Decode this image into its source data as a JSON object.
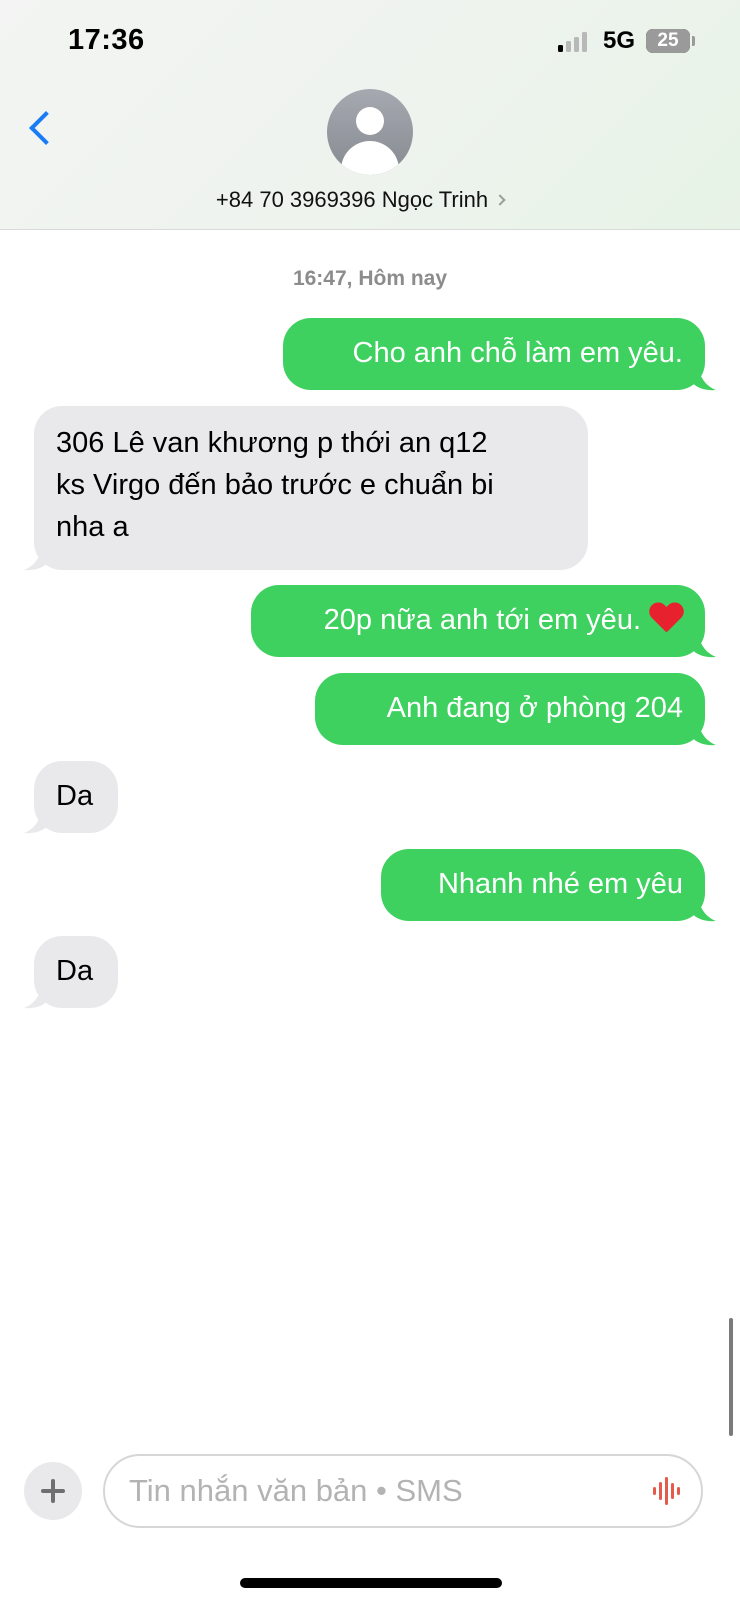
{
  "status_bar": {
    "time": "17:36",
    "network": "5G",
    "battery": "25"
  },
  "header": {
    "contact": "+84 70 3969396 Ngọc Trinh",
    "back_icon": "chevron-left-icon",
    "avatar_icon": "person-icon"
  },
  "conversation": {
    "timestamp": "16:47, Hôm nay",
    "messages": [
      {
        "side": "sent",
        "text": "Cho anh chỗ làm em yêu."
      },
      {
        "side": "received",
        "lines": [
          "306 Lê van khương p thới an q12",
          "ks Virgo đến bảo trước e chuẩn bi",
          "nha a"
        ]
      },
      {
        "side": "sent",
        "text": "20p nữa anh tới em yêu.",
        "emoji": "❤️"
      },
      {
        "side": "sent",
        "text": "Anh đang ở phòng 204"
      },
      {
        "side": "received",
        "text": "Da"
      },
      {
        "side": "sent",
        "text": "Nhanh nhé em yêu"
      },
      {
        "side": "received",
        "text": "Da"
      }
    ]
  },
  "composer": {
    "placeholder": "Tin nhắn văn bản • SMS",
    "plus_icon": "plus-icon",
    "mic_icon": "waveform-icon"
  },
  "colors": {
    "sent_bubble": "#3ed15f",
    "received_bubble": "#e9e9eb",
    "accent": "#1a7cf5"
  }
}
